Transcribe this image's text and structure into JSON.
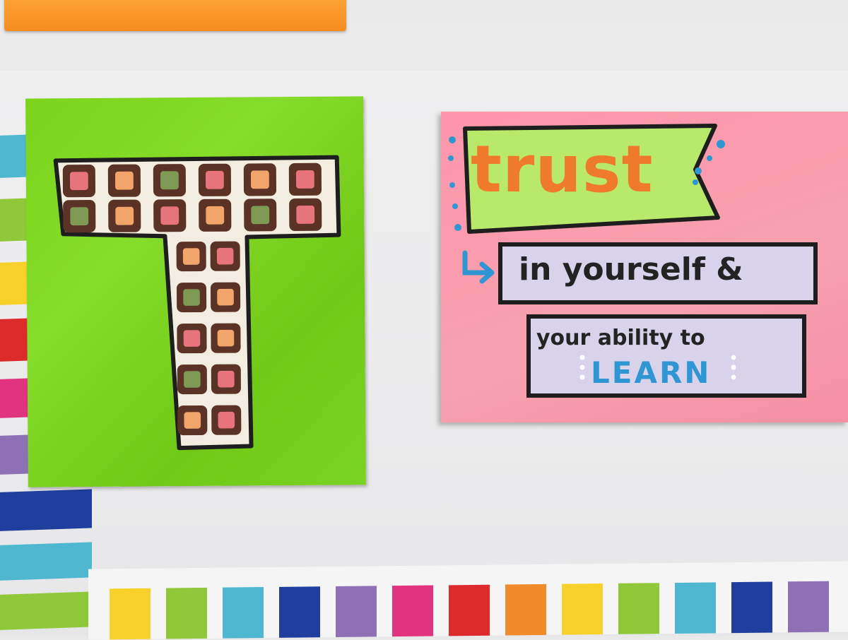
{
  "photo": {
    "scene": "photo-of-wall",
    "quote_canvas": {
      "word_1": "trust",
      "line_2": "in yourself &",
      "line_3": "your ability to",
      "word_4": "LEARN"
    },
    "t_canvas": {
      "letter": "T"
    },
    "colors": {
      "green_canvas": "#7bd41c",
      "pink_canvas": "#f89aad",
      "orange_text": "#ef7a2c",
      "learn_blue": "#2f96d3",
      "banner_lime": "#b9e96a",
      "banner_lavender": "#d8d3ea",
      "frame_black": "#1e1e1e",
      "t_tile_brown": "#5a3326"
    },
    "bar_colors": [
      "#f7d12a",
      "#8fc83a",
      "#4fb7d0",
      "#1f3e9d",
      "#8e71b5",
      "#e0357e",
      "#dd2b2b",
      "#f08a2a",
      "#f7d12a",
      "#8fc83a",
      "#4fb7d0",
      "#1f3e9d",
      "#8e71b5"
    ]
  }
}
